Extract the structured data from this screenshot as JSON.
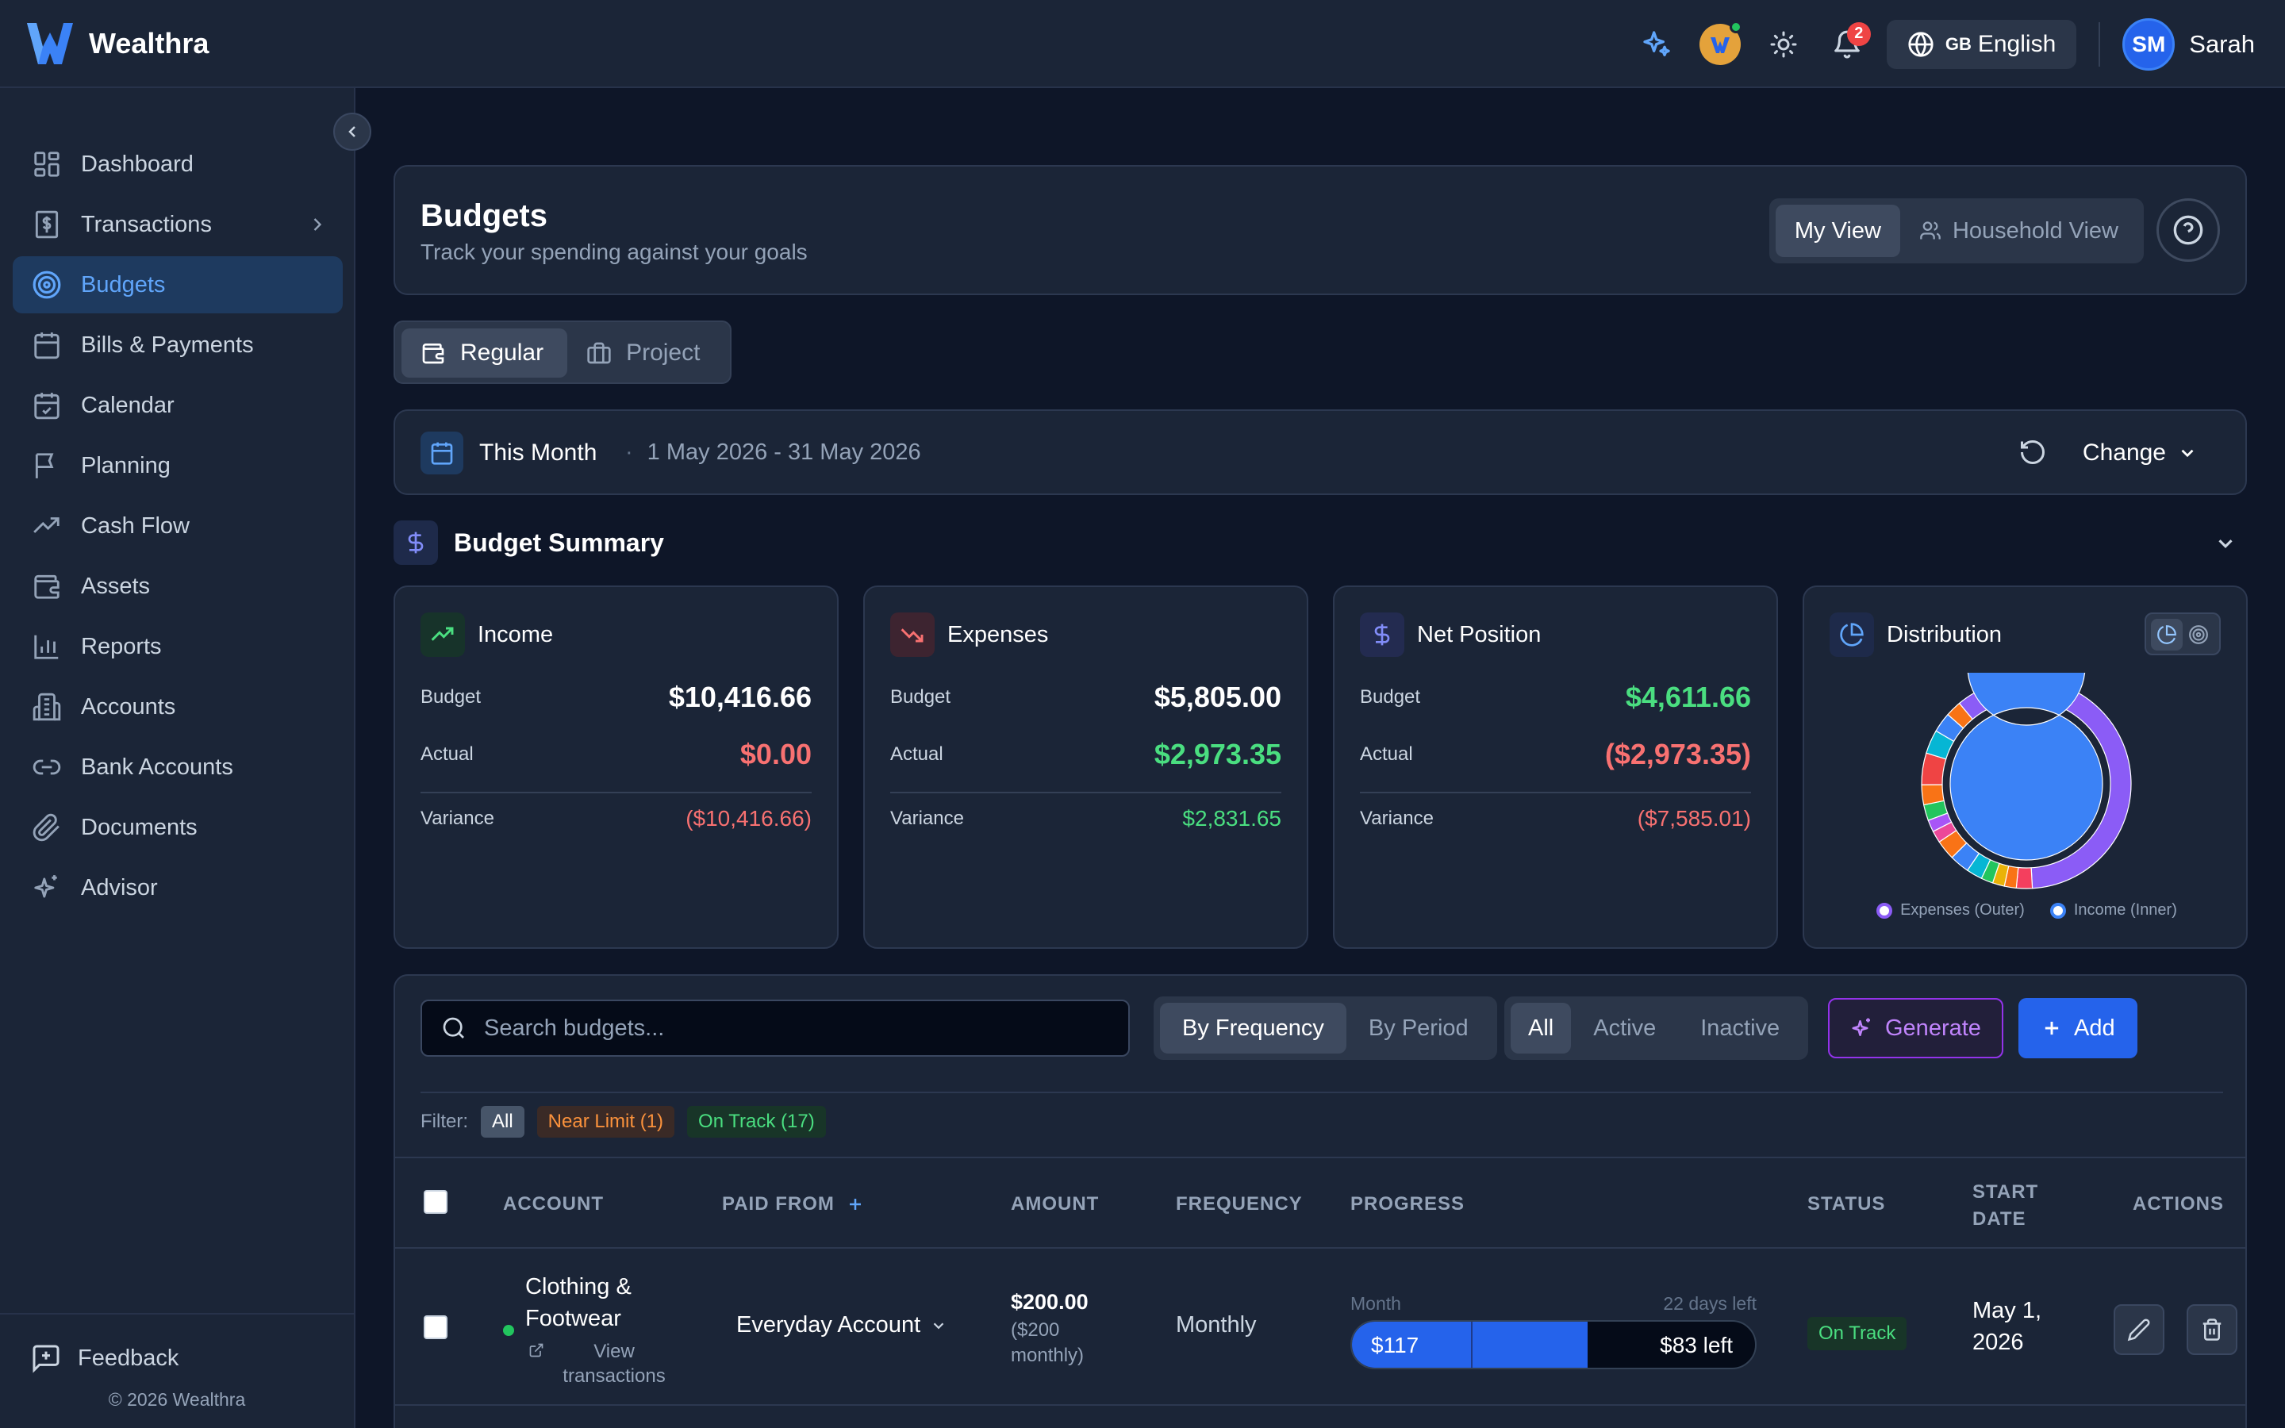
{
  "app": {
    "name": "Wealthra"
  },
  "topbar": {
    "notifications_count": "2",
    "language_flag": "GB",
    "language": "English",
    "user_initials": "SM",
    "user_name": "Sarah"
  },
  "sidebar": {
    "items": [
      {
        "label": "Dashboard",
        "icon": "dashboard-icon"
      },
      {
        "label": "Transactions",
        "icon": "dollar-receipt-icon"
      },
      {
        "label": "Budgets",
        "icon": "target-icon"
      },
      {
        "label": "Bills & Payments",
        "icon": "bill-calendar-icon"
      },
      {
        "label": "Calendar",
        "icon": "calendar-check-icon"
      },
      {
        "label": "Planning",
        "icon": "flag-icon"
      },
      {
        "label": "Cash Flow",
        "icon": "trend-up-icon"
      },
      {
        "label": "Assets",
        "icon": "wallet-icon"
      },
      {
        "label": "Reports",
        "icon": "bar-chart-icon"
      },
      {
        "label": "Accounts",
        "icon": "building-icon"
      },
      {
        "label": "Bank Accounts",
        "icon": "link-icon"
      },
      {
        "label": "Documents",
        "icon": "paperclip-icon"
      },
      {
        "label": "Advisor",
        "icon": "sparkles-icon"
      }
    ],
    "active": "Budgets",
    "feedback": "Feedback",
    "copyright": "© 2026 Wealthra"
  },
  "header": {
    "title": "Budgets",
    "subtitle": "Track your spending against your goals",
    "view_my": "My View",
    "view_household": "Household View"
  },
  "budget_type": {
    "regular": "Regular",
    "project": "Project"
  },
  "period": {
    "name": "This Month",
    "dates": "1 May 2026 - 31 May 2026",
    "change": "Change"
  },
  "summary": {
    "title": "Budget Summary",
    "income": {
      "title": "Income",
      "budget_label": "Budget",
      "budget": "$10,416.66",
      "actual_label": "Actual",
      "actual": "$0.00",
      "variance_label": "Variance",
      "variance": "($10,416.66)"
    },
    "expenses": {
      "title": "Expenses",
      "budget_label": "Budget",
      "budget": "$5,805.00",
      "actual_label": "Actual",
      "actual": "$2,973.35",
      "variance_label": "Variance",
      "variance": "$2,831.65"
    },
    "net": {
      "title": "Net Position",
      "budget_label": "Budget",
      "budget": "$4,611.66",
      "actual_label": "Actual",
      "actual": "($2,973.35)",
      "variance_label": "Variance",
      "variance": "($7,585.01)"
    },
    "distribution": {
      "title": "Distribution",
      "legend_outer": "Expenses (Outer)",
      "legend_inner": "Income (Inner)"
    }
  },
  "chart_data": {
    "type": "pie",
    "series": [
      {
        "name": "Expenses (Outer)",
        "values": [
          40,
          2,
          1.5,
          1.5,
          1.5,
          2,
          2.5,
          2.5,
          1.5,
          1.5,
          2,
          2.5,
          4,
          3,
          2.5,
          2,
          9
        ],
        "colors": [
          "#8b5cf6",
          "#f43f5e",
          "#f97316",
          "#eab308",
          "#22c55e",
          "#06b6d4",
          "#3b82f6",
          "#f97316",
          "#ec4899",
          "#a855f7",
          "#22c55e",
          "#f97316",
          "#ef4444",
          "#06b6d4",
          "#3b82f6",
          "#f97316",
          "#8b5cf6"
        ]
      },
      {
        "name": "Income (Inner)",
        "values": [
          100
        ],
        "colors": [
          "#3b82f6"
        ]
      }
    ]
  },
  "toolbar": {
    "search_placeholder": "Search budgets...",
    "by_frequency": "By Frequency",
    "by_period": "By Period",
    "all": "All",
    "active": "Active",
    "inactive": "Inactive",
    "generate": "Generate",
    "add": "Add"
  },
  "filter": {
    "label": "Filter:",
    "all": "All",
    "near_limit": "Near Limit (1)",
    "on_track": "On Track (17)"
  },
  "table": {
    "columns": [
      "ACCOUNT",
      "PAID FROM",
      "AMOUNT",
      "FREQUENCY",
      "PROGRESS",
      "STATUS",
      "START DATE",
      "ACTIONS"
    ],
    "rows": [
      {
        "account": "Clothing & Footwear",
        "view_transactions": "View transactions",
        "paid_from": "Everyday Account",
        "amount": "$200.00",
        "amount_sub": "($200 monthly)",
        "frequency": "Monthly",
        "progress_period": "Month",
        "progress_days": "22 days left",
        "progress_spent": "$117",
        "progress_left": "$83 left",
        "progress_fraction": 0.585,
        "status": "On Track",
        "start_date": "May 1, 2026"
      }
    ]
  }
}
